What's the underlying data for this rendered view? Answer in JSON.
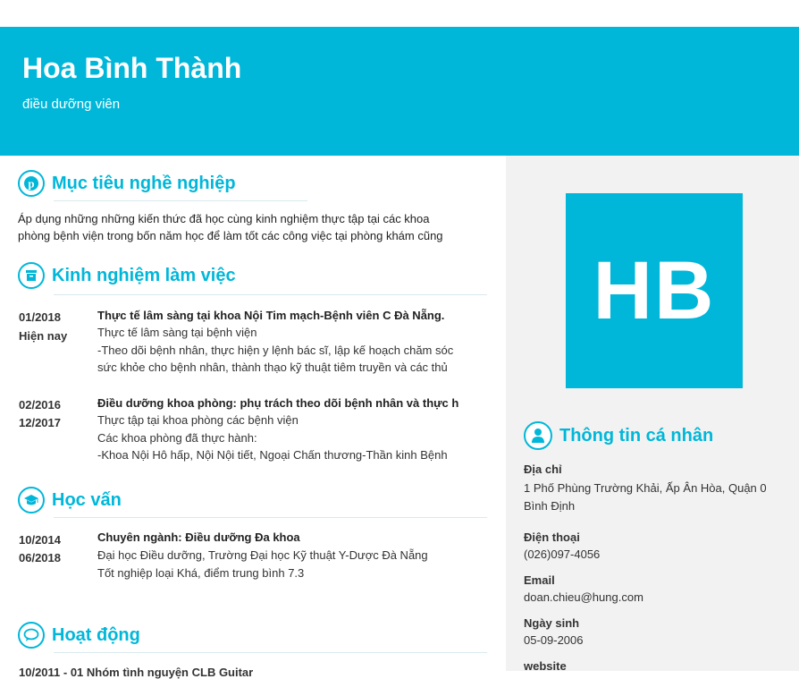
{
  "header": {
    "name": "Hoa Bình Thành",
    "job_title": "điều dưỡng viên"
  },
  "avatar": {
    "initials": "HB"
  },
  "sections": {
    "objective": {
      "title": "Mục tiêu nghề nghiệp",
      "icon": "pinterest-icon",
      "lines": [
        "Áp dụng những những kiến thức đã học cùng kinh nghiệm thực tập tại các khoa",
        "phòng bệnh viện trong bốn năm học để làm tốt các công việc tại phòng khám cũng"
      ]
    },
    "experience": {
      "title": "Kinh nghiệm làm việc",
      "icon": "archive-icon",
      "entries": [
        {
          "date_from": "01/2018",
          "date_to": "Hiện nay",
          "title": "Thực tế lâm sàng tại khoa Nội Tim mạch-Bệnh viên C Đà Nẵng.",
          "lines": [
            "Thực tế lâm sàng tại bệnh viện",
            "-Theo dõi bệnh nhân, thực hiện y lệnh bác sĩ, lập kế hoạch chăm sóc",
            "sức khỏe cho bệnh nhân, thành thạo kỹ thuật tiêm truyền và các thủ"
          ]
        },
        {
          "date_from": "02/2016",
          "date_to": "12/2017",
          "title": "Điều dưỡng khoa phòng: phụ trách theo dõi bệnh nhân và thực h",
          "lines": [
            "Thực tập tại khoa phòng các bệnh viện",
            "Các khoa phòng đã thực hành:",
            "-Khoa Nội Hô hấp, Nội Nội tiết, Ngoại Chấn thương-Thần kinh Bệnh"
          ]
        }
      ]
    },
    "education": {
      "title": "Học vấn",
      "icon": "graduation-cap-icon",
      "entries": [
        {
          "date_from": "10/2014",
          "date_to": "06/2018",
          "title": "Chuyên ngành: Điều dưỡng Đa khoa",
          "lines": [
            "Đại học Điều dưỡng, Trường Đại học Kỹ thuật Y-Dược Đà Nẵng",
            "Tốt nghiệp loại Khá, điểm trung bình 7.3"
          ]
        }
      ]
    },
    "activities": {
      "title": "Hoạt động",
      "icon": "speech-bubble-icon",
      "partial_line": "10/2011 - 01  Nhóm tình nguyện CLB Guitar"
    },
    "personal_info": {
      "title": "Thông tin cá nhân",
      "icon": "user-icon",
      "address_label": "Địa chỉ",
      "address_lines": [
        "1 Phố Phùng Trường Khải, Ấp Ân Hòa, Quận 0",
        "Bình Định"
      ],
      "phone_label": "Điện thoại",
      "phone": "(026)097-4056",
      "email_label": "Email",
      "email": "doan.chieu@hung.com",
      "dob_label": "Ngày sinh",
      "dob": "05-09-2006",
      "website_label": "website"
    }
  },
  "colors": {
    "accent": "#00b7d9",
    "sidebar_bg": "#f2f2f2"
  }
}
